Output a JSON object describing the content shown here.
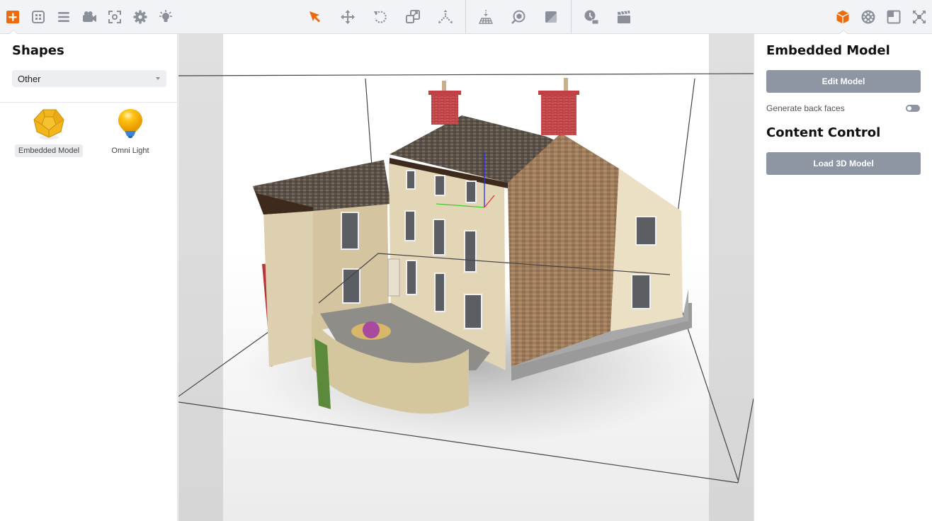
{
  "toolbar": {
    "left_icons": [
      {
        "name": "add-shape-icon",
        "active": true
      },
      {
        "name": "layout-grid-icon",
        "active": false
      },
      {
        "name": "list-icon",
        "active": false
      },
      {
        "name": "camera-icon",
        "active": false
      },
      {
        "name": "focus-icon",
        "active": false
      },
      {
        "name": "gear-icon",
        "active": false
      },
      {
        "name": "light-icon",
        "active": false
      }
    ],
    "transform_icons": [
      {
        "name": "select-arrow-icon",
        "active": true
      },
      {
        "name": "move-icon",
        "active": false
      },
      {
        "name": "rotate-icon",
        "active": false
      },
      {
        "name": "scale-icon",
        "active": false
      },
      {
        "name": "pivot-icon",
        "active": false
      }
    ],
    "scene_icons": [
      "drop-to-floor-icon",
      "zoom-to-object-icon",
      "material-icon"
    ],
    "animation_icons": [
      "timeline-icon",
      "clapperboard-icon"
    ],
    "right_icons": [
      {
        "name": "object-properties-icon",
        "active": true
      },
      {
        "name": "texture-icon",
        "active": false
      },
      {
        "name": "frame-icon",
        "active": false
      },
      {
        "name": "fullscreen-icon",
        "active": false
      }
    ],
    "accent_color": "#ee6a0c",
    "icon_color": "#8a8f9a"
  },
  "left_panel": {
    "title": "Shapes",
    "category_select": {
      "value": "Other"
    },
    "shapes": [
      {
        "label": "Embedded Model",
        "selected": true
      },
      {
        "label": "Omni Light",
        "selected": false
      }
    ]
  },
  "viewport": {
    "description": "3D view of a textured two-storey house model inside a bounding box with axis gizmo"
  },
  "right_panel": {
    "section1_title": "Embedded Model",
    "edit_model_label": "Edit Model",
    "back_faces_label": "Generate back faces",
    "back_faces_enabled": false,
    "section2_title": "Content Control",
    "load_model_label": "Load 3D Model",
    "button_color": "#8e95a3"
  }
}
